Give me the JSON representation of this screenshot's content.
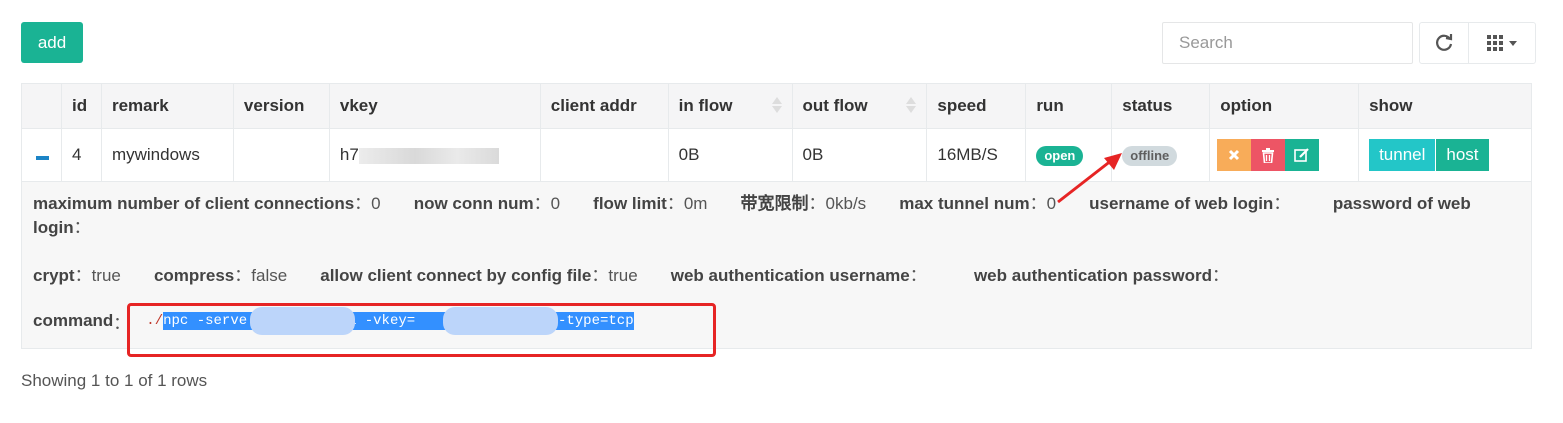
{
  "toolbar": {
    "add_label": "add",
    "search_placeholder": "Search",
    "refresh_icon": "refresh-icon",
    "columns_icon": "grid-columns-icon"
  },
  "table": {
    "headers": [
      "",
      "id",
      "remark",
      "version",
      "vkey",
      "client addr",
      "in flow",
      "out flow",
      "speed",
      "run",
      "status",
      "option",
      "show"
    ],
    "row": {
      "id": "4",
      "remark": "mywindows",
      "version": "",
      "vkey": "h7",
      "client_addr": "",
      "in_flow": "0B",
      "out_flow": "0B",
      "speed": "16MB/S",
      "run": "open",
      "status": "offline",
      "show_tunnel": "tunnel",
      "show_host": "host"
    }
  },
  "detail": {
    "line1": [
      {
        "label": "maximum number of client connections",
        "value": "0"
      },
      {
        "label": "now conn num",
        "value": "0"
      },
      {
        "label": "flow limit",
        "value": "0m"
      },
      {
        "label": "带宽限制",
        "value": "0kb/s"
      },
      {
        "label": "max tunnel num",
        "value": "0"
      },
      {
        "label": "username of web login",
        "value": ""
      },
      {
        "label": "password of web login",
        "value": ""
      }
    ],
    "line2": [
      {
        "label": "crypt",
        "value": "true"
      },
      {
        "label": "compress",
        "value": "false"
      },
      {
        "label": "allow client connect by config file",
        "value": "true"
      },
      {
        "label": "web authentication username",
        "value": ""
      },
      {
        "label": "web authentication password",
        "value": ""
      }
    ],
    "command_label": "command",
    "command_prefix": "./",
    "command_part1": "npc -serve",
    "command_part2": "011 -vkey=",
    "command_part3": "lj0 -type=tcp"
  },
  "footer": {
    "text": "Showing 1 to 1 of 1 rows"
  },
  "colors": {
    "primary": "#1ab394",
    "warning": "#f8ac59",
    "danger": "#ed5565",
    "info": "#23c6c8",
    "annotation": "#e62424"
  }
}
